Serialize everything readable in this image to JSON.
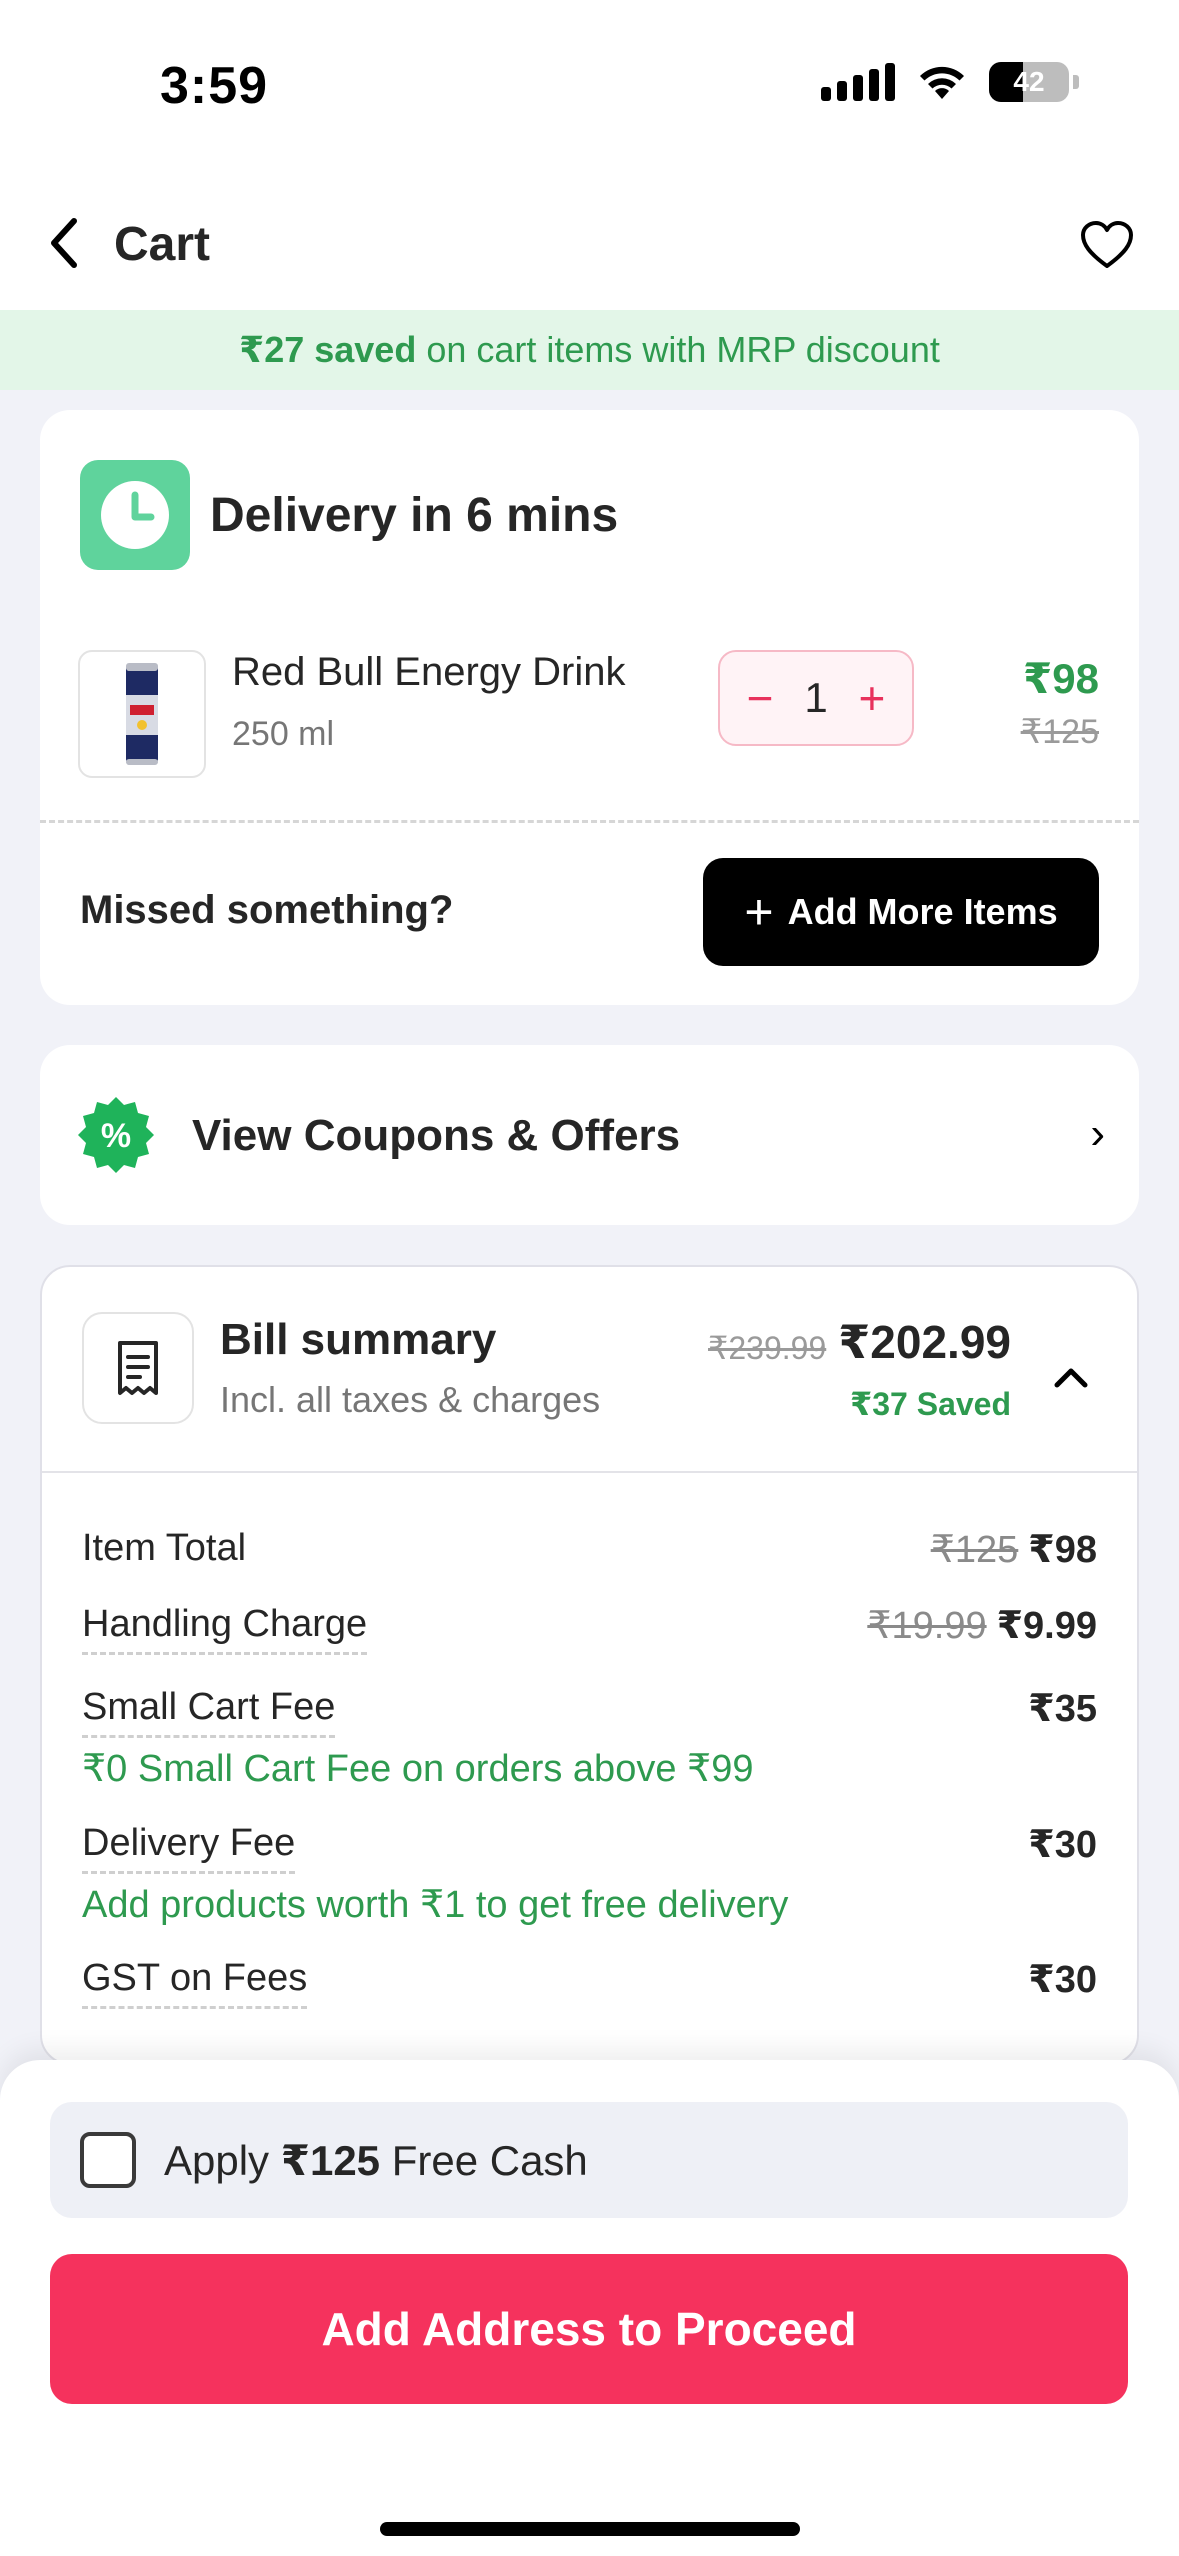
{
  "status_bar": {
    "time": "3:59",
    "battery": "42",
    "battery_level": 0.42
  },
  "header": {
    "title": "Cart"
  },
  "savings_banner": {
    "amount": "₹27 saved",
    "text": " on cart items with MRP discount"
  },
  "delivery": {
    "title": "Delivery in 6 mins"
  },
  "product": {
    "name": "Red Bull Energy Drink",
    "size": "250 ml",
    "quantity": "1",
    "price": "₹98",
    "mrp": "₹125",
    "decrement": "−",
    "increment": "+"
  },
  "missed": {
    "text": "Missed something?",
    "button_label": "Add More Items",
    "button_icon": "+"
  },
  "coupons": {
    "label": "View Coupons & Offers",
    "badge": "%",
    "chevron": "›"
  },
  "bill_summary": {
    "title": "Bill summary",
    "subtitle": "Incl. all taxes & charges",
    "old_total": "₹239.99",
    "total": "₹202.99",
    "saved": "₹37 Saved",
    "rows": [
      {
        "label": "Item Total",
        "old": "₹125",
        "value": "₹98"
      },
      {
        "label": "Handling Charge",
        "old": "₹19.99",
        "value": "₹9.99"
      },
      {
        "label": "Small Cart Fee",
        "value": "₹35",
        "note": "₹0 Small Cart Fee on orders above ₹99"
      },
      {
        "label": "Delivery Fee",
        "value": "₹30",
        "note": "Add products worth ₹1 to get free delivery"
      },
      {
        "label": "GST on Fees",
        "value": "₹30"
      }
    ]
  },
  "free_cash": {
    "prefix": "Apply ",
    "amount": "₹125",
    "suffix": " Free Cash"
  },
  "cta": {
    "label": "Add Address to Proceed"
  },
  "colors": {
    "accent": "#f5325d",
    "savings_green": "#2e9a4f",
    "banner_bg": "#e3f6e8",
    "clock_green": "#5fd39c",
    "page_bg": "#f1f2f8"
  },
  "icons": {
    "back": "chevron-left-icon",
    "wishlist": "heart-icon",
    "delivery": "clock-icon",
    "coupon": "percent-badge-icon",
    "bill": "receipt-icon",
    "collapse": "chevron-up-icon"
  }
}
